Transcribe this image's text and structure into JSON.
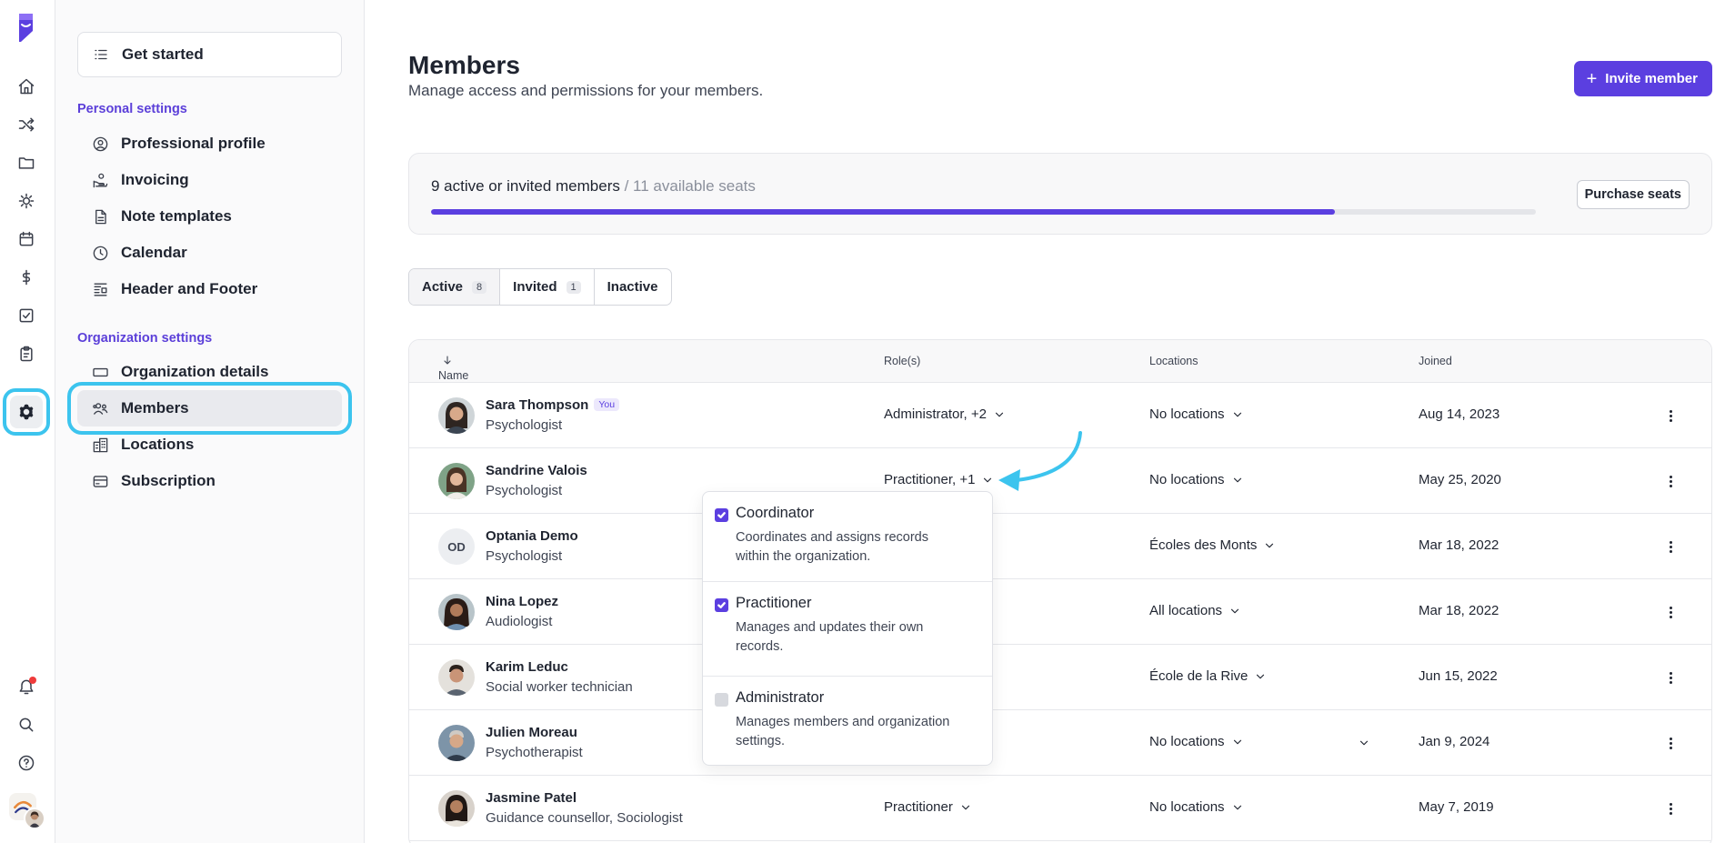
{
  "colors": {
    "accent": "#5b3fe0",
    "highlight_ring": "#3cc4ee",
    "notification": "#ef3b3b"
  },
  "rail": {
    "icons": [
      "home-icon",
      "shuffle-icon",
      "folder-icon",
      "analytics-icon",
      "calendar-icon",
      "dollar-icon",
      "checkbox-icon",
      "clipboard-icon",
      "settings-icon"
    ],
    "bottom_icons": [
      "bell-icon",
      "search-icon",
      "help-icon"
    ]
  },
  "sidebar": {
    "get_started": "Get started",
    "personal_title": "Personal settings",
    "personal": [
      {
        "label": "Professional profile",
        "icon": "user-circle-icon"
      },
      {
        "label": "Invoicing",
        "icon": "hand-coin-icon"
      },
      {
        "label": "Note templates",
        "icon": "document-icon"
      },
      {
        "label": "Calendar",
        "icon": "clock-icon"
      },
      {
        "label": "Header and Footer",
        "icon": "header-footer-icon"
      }
    ],
    "org_title": "Organization settings",
    "org": [
      {
        "label": "Organization details",
        "icon": "card-icon"
      },
      {
        "label": "Members",
        "icon": "users-icon"
      },
      {
        "label": "Locations",
        "icon": "building-icon"
      },
      {
        "label": "Subscription",
        "icon": "credit-card-icon"
      }
    ]
  },
  "header": {
    "title": "Members",
    "subtitle": "Manage access and permissions for your members.",
    "invite_label": "Invite member"
  },
  "seats": {
    "active_text": "9 active or invited members",
    "available_text": " / 11 available seats",
    "progress": 0.818,
    "purchase_label": "Purchase seats"
  },
  "tabs": [
    {
      "label": "Active",
      "count": "8"
    },
    {
      "label": "Invited",
      "count": "1"
    },
    {
      "label": "Inactive",
      "count": ""
    }
  ],
  "table": {
    "headers": {
      "name": "Name",
      "roles": "Role(s)",
      "locations": "Locations",
      "joined": "Joined"
    },
    "rows": [
      {
        "name": "Sara Thompson",
        "you": "You",
        "title": "Psychologist",
        "roles": "Administrator, +2",
        "locations": "No locations",
        "joined": "Aug 14, 2023",
        "initials": ""
      },
      {
        "name": "Sandrine Valois",
        "you": "",
        "title": "Psychologist",
        "roles": "Practitioner, +1",
        "locations": "No locations",
        "joined": "May 25, 2020",
        "initials": ""
      },
      {
        "name": "Optania Demo",
        "you": "",
        "title": "Psychologist",
        "roles": "",
        "locations": "Écoles des Monts",
        "joined": "Mar 18, 2022",
        "initials": "OD"
      },
      {
        "name": "Nina Lopez",
        "you": "",
        "title": "Audiologist",
        "roles": "",
        "locations": "All locations",
        "joined": "Mar 18, 2022",
        "initials": ""
      },
      {
        "name": "Karim Leduc",
        "you": "",
        "title": "Social worker technician",
        "roles": "",
        "locations": "École de la Rive",
        "joined": "Jun 15, 2022",
        "initials": ""
      },
      {
        "name": "Julien Moreau",
        "you": "",
        "title": "Psychotherapist",
        "roles": "",
        "locations": "No locations",
        "joined": "Jan 9, 2024",
        "initials": ""
      },
      {
        "name": "Jasmine Patel",
        "you": "",
        "title": "Guidance counsellor, Sociologist",
        "roles": "Practitioner",
        "locations": "No locations",
        "joined": "May 7, 2019",
        "initials": ""
      }
    ]
  },
  "roles_dropdown": [
    {
      "title": "Coordinator",
      "desc": "Coordinates and assigns records within the organization.",
      "checked": true
    },
    {
      "title": "Practitioner",
      "desc": "Manages and updates their own records.",
      "checked": true
    },
    {
      "title": "Administrator",
      "desc": "Manages members and organization settings.",
      "checked": false
    }
  ]
}
